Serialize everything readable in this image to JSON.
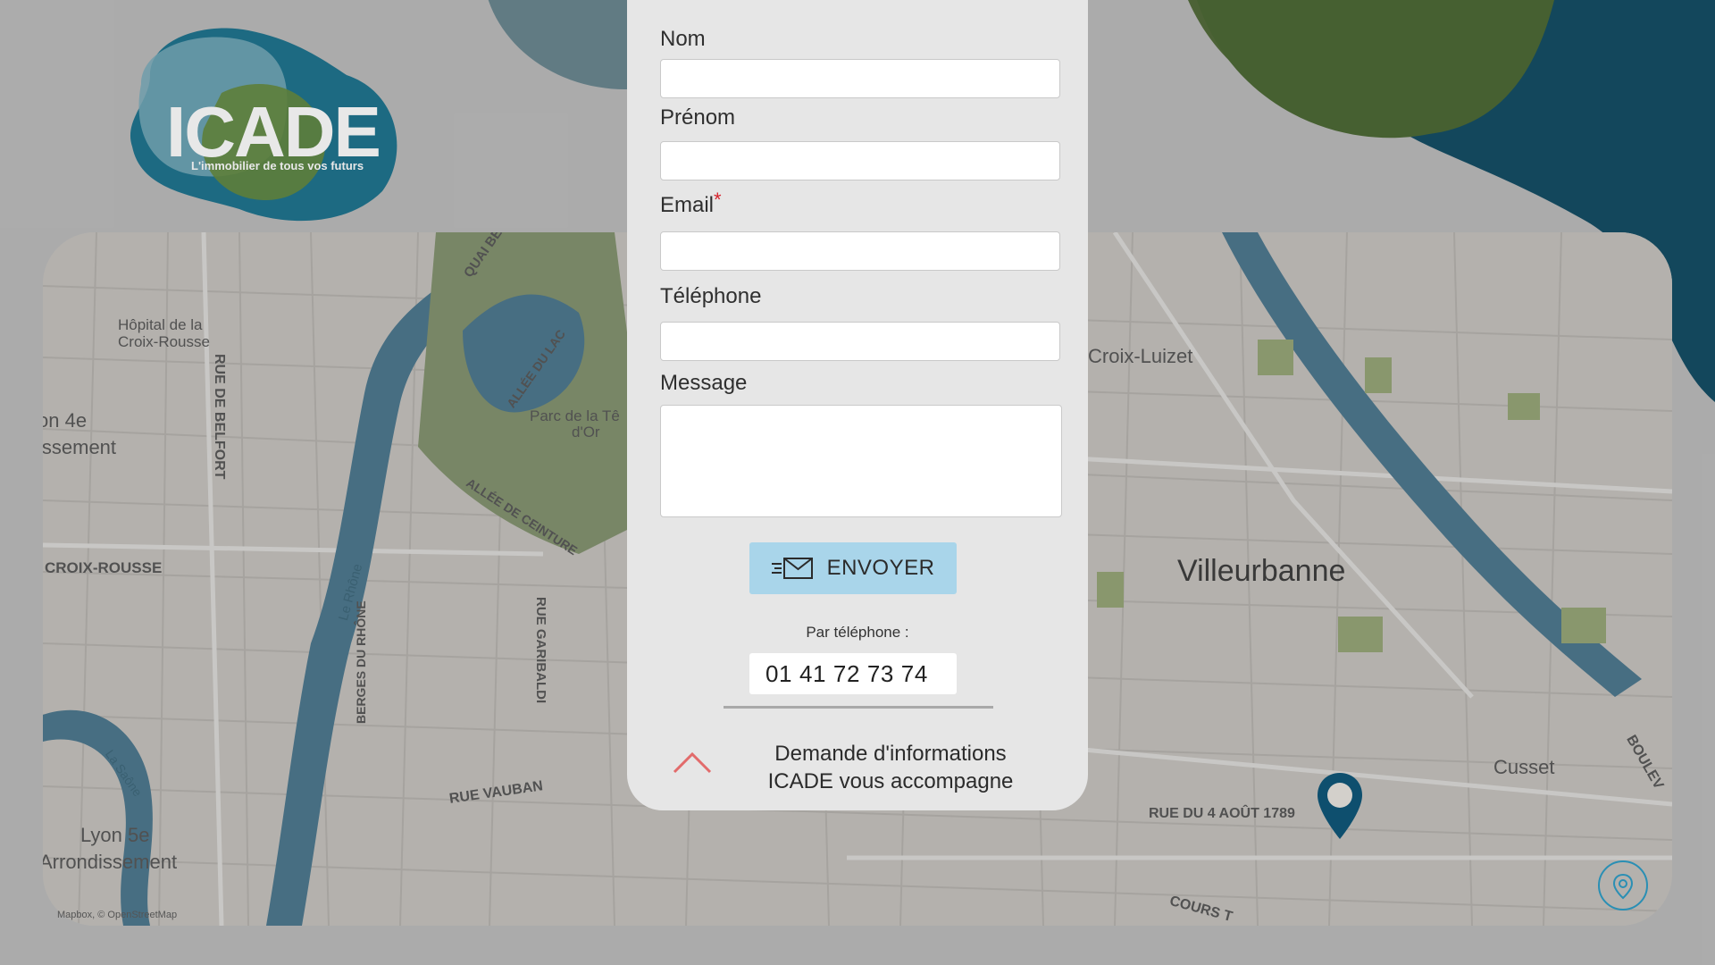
{
  "brand": {
    "logo_text": "ICADE",
    "tagline": "L'immobilier de tous vos futurs"
  },
  "form": {
    "nom_label": "Nom",
    "prenom_label": "Prénom",
    "email_label": "Email",
    "email_required": "*",
    "telephone_label": "Téléphone",
    "message_label": "Message",
    "nom_value": "",
    "prenom_value": "",
    "email_value": "",
    "telephone_value": "",
    "message_value": "",
    "send_label": "ENVOYER"
  },
  "contact": {
    "phone_caption": "Par téléphone :",
    "phone_number": "01 41 72 73 74"
  },
  "footer": {
    "line1": "Demande d'informations",
    "line2": "ICADE vous accompagne"
  },
  "map": {
    "labels": {
      "hospital1": "Hôpital de la",
      "hospital2": "Croix-Rousse",
      "arr4a": "on 4e",
      "arr4b": "issement",
      "croix_rousse": "CROIX-ROUSSE",
      "rue_belfort": "RUE DE BELFORT",
      "quai": "QUAI BE",
      "allee_lac": "ALLÉE DU LAC",
      "parc1": "Parc de la Tê",
      "parc2": "d'Or",
      "allee_ceinture": "ALLÉE DE CEINTURE",
      "le_rhone": "Le Rhône",
      "berges": "BERGES DU RHÔNE",
      "garibaldi": "RUE GARIBALDI",
      "vauban": "RUE VAUBAN",
      "la_saone": "La Saône",
      "lyon5a": "Lyon 5e",
      "lyon5b": "Arrondissement",
      "croix_luizet": "Croix-Luizet",
      "villeurbanne": "Villeurbanne",
      "cusset": "Cusset",
      "aout": "RUE DU 4 AOÛT 1789",
      "cours": "COURS T",
      "boulev": "BOULEV"
    },
    "attribution": "Mapbox, © OpenStreetMap"
  },
  "colors": {
    "accent_blue": "#a9d5ea",
    "required": "#d6232c",
    "pin": "#0e4f6e",
    "chevron": "#e26b6b"
  }
}
